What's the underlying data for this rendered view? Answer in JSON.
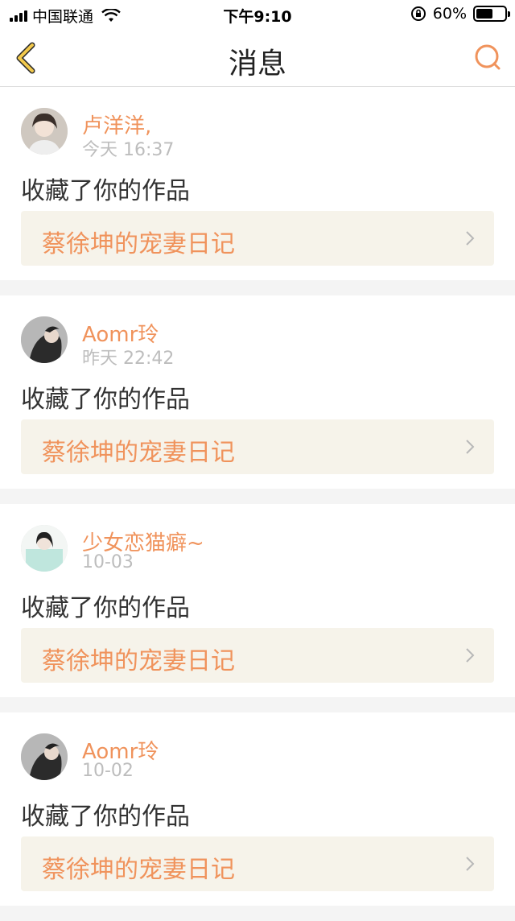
{
  "status_bar": {
    "carrier": "中国联通",
    "time": "下午9:10",
    "battery": "60%",
    "battery_level": 0.6
  },
  "nav": {
    "title": "消息",
    "back_icon": "chevron-left-icon",
    "search_icon": "search-icon"
  },
  "messages": [
    {
      "user": "卢洋洋,",
      "time": "今天 16:37",
      "action": "收藏了你的作品",
      "work": "蔡徐坤的宠妻日记"
    },
    {
      "user": "Aomr玲",
      "time": "昨天 22:42",
      "action": "收藏了你的作品",
      "work": "蔡徐坤的宠妻日记"
    },
    {
      "user": "少女恋猫癖~",
      "time": "10-03",
      "action": "收藏了你的作品",
      "work": "蔡徐坤的宠妻日记"
    },
    {
      "user": "Aomr玲",
      "time": "10-02",
      "action": "收藏了你的作品",
      "work": "蔡徐坤的宠妻日记"
    }
  ],
  "colors": {
    "accent": "#f0935c",
    "nav_icon_back": "#f2c94c",
    "work_box_bg": "#f6f3ea",
    "divider_bg": "#f4f4f4"
  }
}
